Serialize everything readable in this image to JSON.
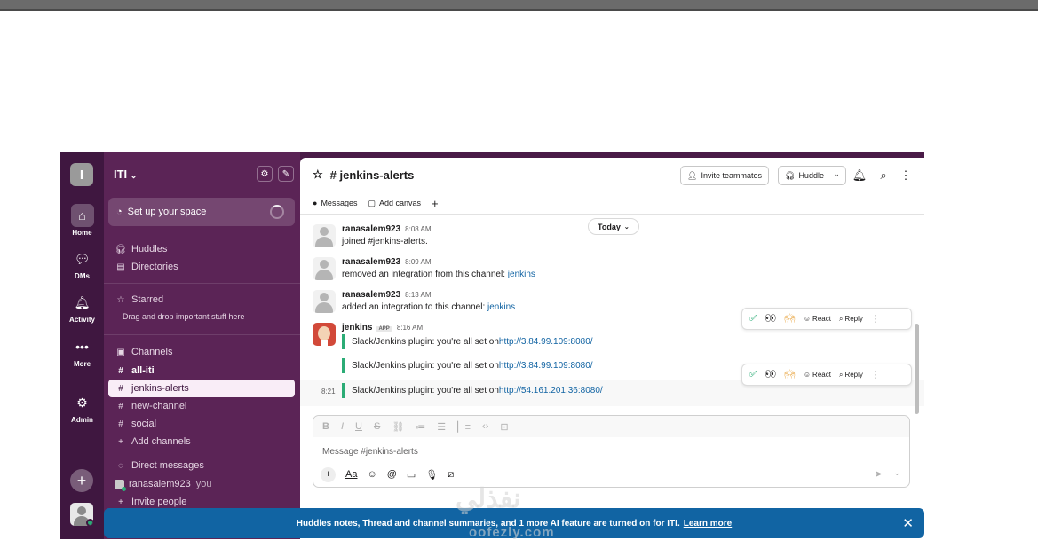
{
  "rail": {
    "workspace_initial": "I",
    "home": "Home",
    "dms": "DMs",
    "activity": "Activity",
    "more": "More",
    "admin": "Admin"
  },
  "sidebar": {
    "workspace_name": "ITI",
    "setup": "Set up your space",
    "huddles": "Huddles",
    "directories": "Directories",
    "starred": "Starred",
    "starred_hint": "Drag and drop important stuff here",
    "channels_header": "Channels",
    "channels": [
      "all-iti",
      "jenkins-alerts",
      "new-channel",
      "social"
    ],
    "add_channels": "Add channels",
    "dm_header": "Direct messages",
    "dm_user": "ranasalem923",
    "dm_you": "you",
    "invite": "Invite people"
  },
  "header": {
    "channel": "jenkins-alerts",
    "invite": "Invite teammates",
    "huddle": "Huddle",
    "tabs": [
      "Messages",
      "Add canvas"
    ]
  },
  "divider": {
    "today": "Today"
  },
  "messages": [
    {
      "user": "ranasalem923",
      "time": "8:08 AM",
      "text": "joined #jenkins-alerts."
    },
    {
      "user": "ranasalem923",
      "time": "8:09 AM",
      "text": "removed an integration from this channel: ",
      "link": "jenkins"
    },
    {
      "user": "ranasalem923",
      "time": "8:13 AM",
      "text": "added an integration to this channel: ",
      "link": "jenkins"
    },
    {
      "user": "jenkins",
      "badge": "APP",
      "time": "8:16 AM"
    }
  ],
  "attachments": [
    {
      "text": "Slack/Jenkins plugin: you're all set on ",
      "link": "http://3.84.99.109:8080/"
    },
    {
      "text": "Slack/Jenkins plugin: you're all set on ",
      "link": "http://3.84.99.109:8080/"
    },
    {
      "time": "8:21",
      "text": "Slack/Jenkins plugin: you're all set on ",
      "link": "http://54.161.201.36:8080/"
    }
  ],
  "toolbar": {
    "react": "React",
    "reply": "Reply"
  },
  "composer": {
    "placeholder": "Message #jenkins-alerts",
    "aa": "Aa"
  },
  "banner": {
    "text": "Huddles notes, Thread and channel summaries, and 1 more AI feature are turned on for ITI.",
    "learn_more": "Learn more"
  },
  "watermark": {
    "arabic": "نفذلي",
    "latin": "oofezly.com"
  }
}
